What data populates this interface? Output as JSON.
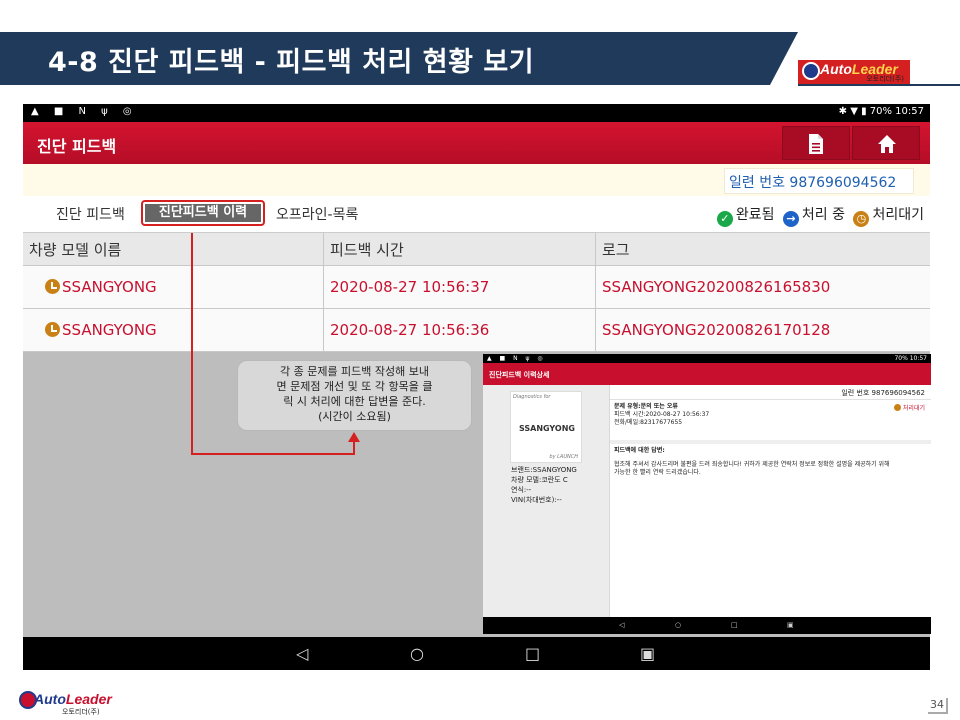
{
  "slide": {
    "title": "4-8 진단 피드백 - 피드백 처리 현황 보기",
    "logo_auto": "Auto",
    "logo_leader": "Leader",
    "logo_sub": "오토리더(주)",
    "page_number": "34"
  },
  "tablet": {
    "status_right": "70%  10:57",
    "app_title": "진단 피드백",
    "serial_label": "일련 번호 987696094562",
    "tabs": [
      "진단 피드백",
      "진단피드백 이력",
      "오프라인-목록"
    ],
    "legend": {
      "done": "완료됨",
      "processing": "처리 중",
      "waiting": "처리대기"
    },
    "table": {
      "headers": [
        "차량 모델 이름",
        "피드백 시간",
        "로그"
      ],
      "rows": [
        [
          "SSANGYONG",
          "2020-08-27 10:56:37",
          "SSANGYONG20200826165830"
        ],
        [
          "SSANGYONG",
          "2020-08-27 10:56:36",
          "SSANGYONG20200826170128"
        ]
      ]
    }
  },
  "callout": {
    "line1": "각 종 문제를 피드백 작성해 보내",
    "line2": "면 문제점 개선 및 또 각 항목을 클",
    "line3": "릭 시 처리에 대한 답변을 준다.",
    "line4": "(시간이 소요됨)"
  },
  "detail": {
    "title": "진단피드백 이력상세",
    "status_right": "70%  10:57",
    "card_diag": "Diagnostics for",
    "card_brand": "SSANGYONG",
    "card_by": "by LAUNCH",
    "info": [
      "브랜드:SSANGYONG",
      "차량 모델:코란도 C",
      "연식:--",
      "VIN(차대번호):--"
    ],
    "serial": "일련 번호  987696094562",
    "problem_type": "문제 유형:문의 또는 오류",
    "feedback_time": "피드백 시간:2020-08-27 10:56:37",
    "contact": "전화/메일:82317677655",
    "status_wait": "처리대기",
    "reply_title": "피드백에 대한 답변:",
    "reply_line1": "협조해 주셔서 감사드리며 불편을 드려 죄송합니다! 귀하가 제공한 연락처 정보로 정확한 설명을 제공하기 위해",
    "reply_line2": "가능한 한 빨리 연락 드리겠습니다."
  },
  "colors": {
    "banner": "#1f3a5a",
    "appbar": "#c8102e",
    "accent_blue": "#1f5fb0",
    "waiting_orange": "#c98015",
    "done_green": "#1aa84a",
    "processing_blue": "#1e63c8"
  }
}
